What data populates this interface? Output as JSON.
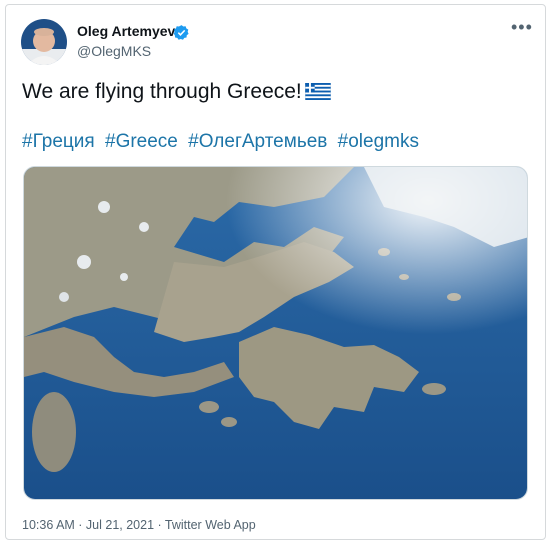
{
  "author": {
    "name": "Oleg Artemyev",
    "handle": "@OlegMKS"
  },
  "tweet": {
    "text": "We are flying through Greece!",
    "flag_icon": "greece-flag-icon",
    "hashtags": [
      "#Греция",
      "#Greece",
      "#ОлегАртемьев",
      "#olegmks"
    ]
  },
  "meta": {
    "line": "10:36 AM · Jul 21, 2021 · Twitter Web App"
  },
  "colors": {
    "link": "#1d75a8",
    "verified": "#1d9bf0",
    "sea": "#1f5f9e",
    "land": "#a39e8c"
  }
}
